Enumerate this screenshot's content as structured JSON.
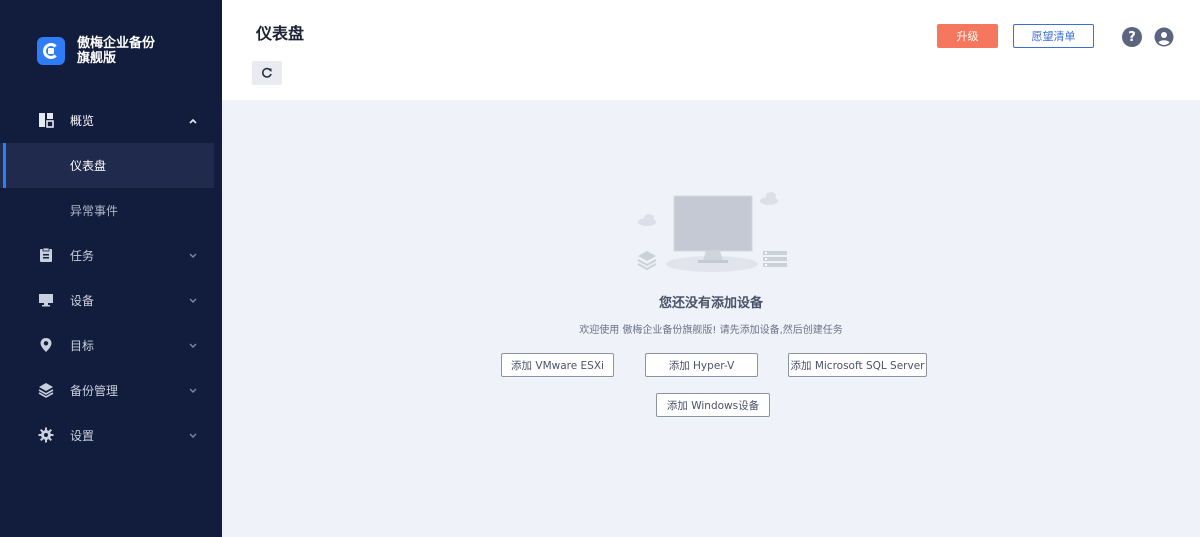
{
  "brand": {
    "line1": "傲梅企业备份",
    "line2": "旗舰版"
  },
  "sidebar": {
    "items": [
      {
        "label": "概览",
        "icon": "dashboard-icon"
      },
      {
        "label": "仪表盘"
      },
      {
        "label": "异常事件"
      },
      {
        "label": "任务",
        "icon": "clipboard-icon"
      },
      {
        "label": "设备",
        "icon": "monitor-icon"
      },
      {
        "label": "目标",
        "icon": "location-pin-icon"
      },
      {
        "label": "备份管理",
        "icon": "layers-icon"
      },
      {
        "label": "设置",
        "icon": "gear-icon"
      }
    ]
  },
  "header": {
    "title": "仪表盘",
    "upgrade_label": "升级",
    "wishlist_label": "愿望清单",
    "help_glyph": "?"
  },
  "empty_state": {
    "title": "您还没有添加设备",
    "description": "欢迎使用 傲梅企业备份旗舰版! 请先添加设备,然后创建任务",
    "buttons": {
      "vmware": "添加 VMware ESXi",
      "hyperv": "添加 Hyper-V",
      "sql": "添加 Microsoft SQL Server",
      "windows": "添加 Windows设备"
    }
  },
  "colors": {
    "sidebar_bg": "#121c3c",
    "accent": "#2e7cf6",
    "upgrade": "#f5775d",
    "wishlist": "#3b6fd8"
  }
}
